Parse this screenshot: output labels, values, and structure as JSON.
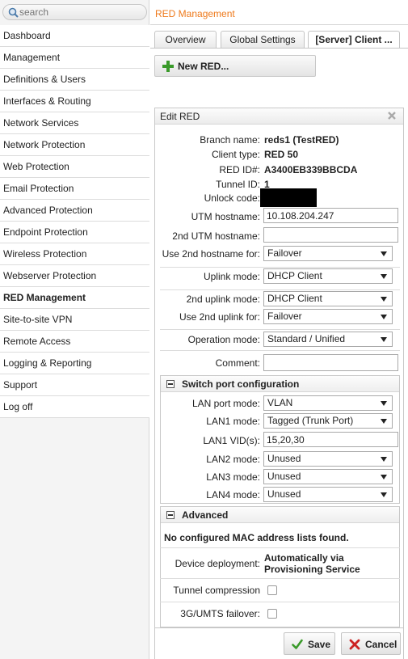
{
  "search": {
    "placeholder": "search"
  },
  "sidebar": {
    "items": [
      "Dashboard",
      "Management",
      "Definitions & Users",
      "Interfaces & Routing",
      "Network Services",
      "Network Protection",
      "Web Protection",
      "Email Protection",
      "Advanced Protection",
      "Endpoint Protection",
      "Wireless Protection",
      "Webserver Protection",
      "RED Management",
      "Site-to-site VPN",
      "Remote Access",
      "Logging & Reporting",
      "Support",
      "Log off"
    ],
    "active_index": 12
  },
  "header": {
    "title": "RED Management"
  },
  "tabs": [
    {
      "label": "Overview"
    },
    {
      "label": "Global Settings"
    },
    {
      "label": "[Server] Client ..."
    }
  ],
  "toolbar": {
    "new_red_label": "New RED..."
  },
  "edit": {
    "title": "Edit RED",
    "branch_name_label": "Branch name:",
    "branch_name": "reds1 (TestRED)",
    "client_type_label": "Client type:",
    "client_type": "RED 50",
    "red_id_label": "RED ID#:",
    "red_id": "A3400EB339BBCDA",
    "tunnel_id_label": "Tunnel ID:",
    "tunnel_id": "1",
    "unlock_code_label": "Unlock code:",
    "utm_hostname_label": "UTM hostname:",
    "utm_hostname": "10.108.204.247",
    "utm2_hostname_label": "2nd UTM hostname:",
    "utm2_hostname": "",
    "use_2nd_hostname_label": "Use 2nd hostname for:",
    "use_2nd_hostname": "Failover",
    "uplink_mode_label": "Uplink mode:",
    "uplink_mode": "DHCP Client",
    "uplink2_mode_label": "2nd uplink mode:",
    "uplink2_mode": "DHCP Client",
    "use_2nd_uplink_label": "Use 2nd uplink for:",
    "use_2nd_uplink": "Failover",
    "operation_mode_label": "Operation mode:",
    "operation_mode": "Standard / Unified",
    "comment_label": "Comment:",
    "comment": ""
  },
  "switch": {
    "title": "Switch port configuration",
    "lan_port_mode_label": "LAN port mode:",
    "lan_port_mode": "VLAN",
    "lan1_mode_label": "LAN1 mode:",
    "lan1_mode": "Tagged (Trunk Port)",
    "lan1_vids_label": "LAN1 VID(s):",
    "lan1_vids": "15,20,30",
    "lan2_mode_label": "LAN2 mode:",
    "lan2_mode": "Unused",
    "lan3_mode_label": "LAN3 mode:",
    "lan3_mode": "Unused",
    "lan4_mode_label": "LAN4 mode:",
    "lan4_mode": "Unused"
  },
  "advanced": {
    "title": "Advanced",
    "mac_note": "No configured MAC address lists found.",
    "device_deployment_label": "Device deployment:",
    "device_deployment_line1": "Automatically via",
    "device_deployment_line2": "Provisioning Service",
    "tunnel_compression_label": "Tunnel compression",
    "tunnel_compression": false,
    "failover_3g_label": "3G/UMTS failover:",
    "failover_3g": false
  },
  "actions": {
    "save_label": "Save",
    "cancel_label": "Cancel"
  },
  "colors": {
    "accent": "#ee7a1c",
    "save_check": "#3a9a2a",
    "cancel_x": "#cc2222",
    "plus": "#3a9a2a"
  }
}
